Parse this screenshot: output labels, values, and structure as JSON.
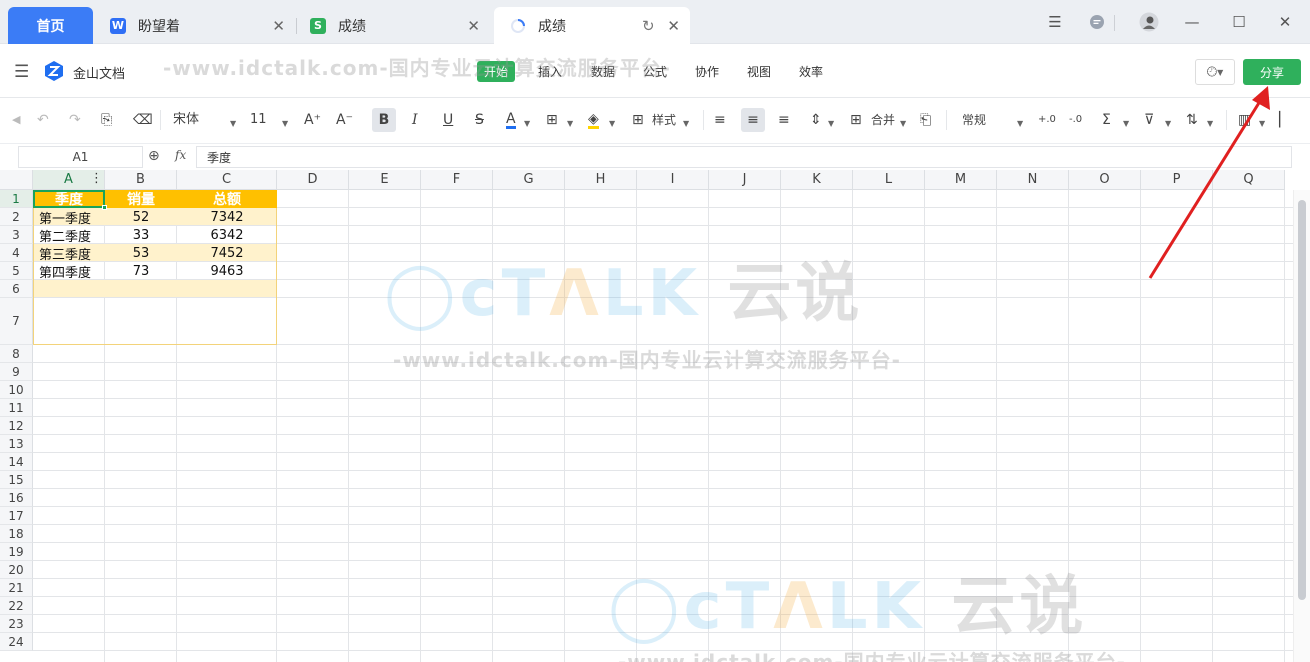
{
  "tabs": {
    "home": "首页",
    "tab1": {
      "label": "盼望着",
      "badge": "W",
      "badge_color": "#2f6ff5"
    },
    "tab2": {
      "label": "成绩",
      "badge": "S",
      "badge_color": "#2fb05c"
    },
    "tab3": {
      "label": "成绩"
    }
  },
  "app": {
    "name": "金山文档"
  },
  "menu": {
    "items": [
      "开始",
      "插入",
      "数据",
      "公式",
      "协作",
      "视图",
      "效率"
    ],
    "active_index": 0,
    "share": "分享"
  },
  "toolbar": {
    "font_name": "宋体",
    "font_size": "11",
    "style_label": "样式",
    "merge_label": "合并",
    "number_format": "常规",
    "bold": "B",
    "italic": "I",
    "underline": "U",
    "strike": "S",
    "font_color_glyph": "A",
    "increase_font": "A⁺",
    "decrease_font": "A⁻"
  },
  "formula_bar": {
    "cell_ref": "A1",
    "fx": "fx",
    "content": "季度"
  },
  "sheet": {
    "columns": [
      "A",
      "B",
      "C",
      "D",
      "E",
      "F",
      "G",
      "H",
      "I",
      "J",
      "K",
      "L",
      "M",
      "N",
      "O",
      "P",
      "Q"
    ],
    "rows": [
      "1",
      "2",
      "3",
      "4",
      "5",
      "6",
      "7",
      "8",
      "9",
      "10",
      "11",
      "12",
      "13",
      "14",
      "15",
      "16",
      "17",
      "18",
      "19",
      "20",
      "21",
      "22",
      "23",
      "24"
    ],
    "table": {
      "header": [
        "季度",
        "销量",
        "总额"
      ],
      "data": [
        [
          "第一季度",
          "52",
          "7342"
        ],
        [
          "第二季度",
          "33",
          "6342"
        ],
        [
          "第三季度",
          "53",
          "7452"
        ],
        [
          "第四季度",
          "73",
          "9463"
        ]
      ],
      "header_color": "#ffc000",
      "band_color": "#fff2cc"
    }
  },
  "watermark": {
    "url_text": "-www.idctalk.com-国内专业云计算交流服务平台-",
    "logo_text": "TALK 云说"
  },
  "colors": {
    "accent_blue": "#3b7cf6",
    "accent_green": "#2fb05c",
    "arrow_red": "#e02020"
  }
}
